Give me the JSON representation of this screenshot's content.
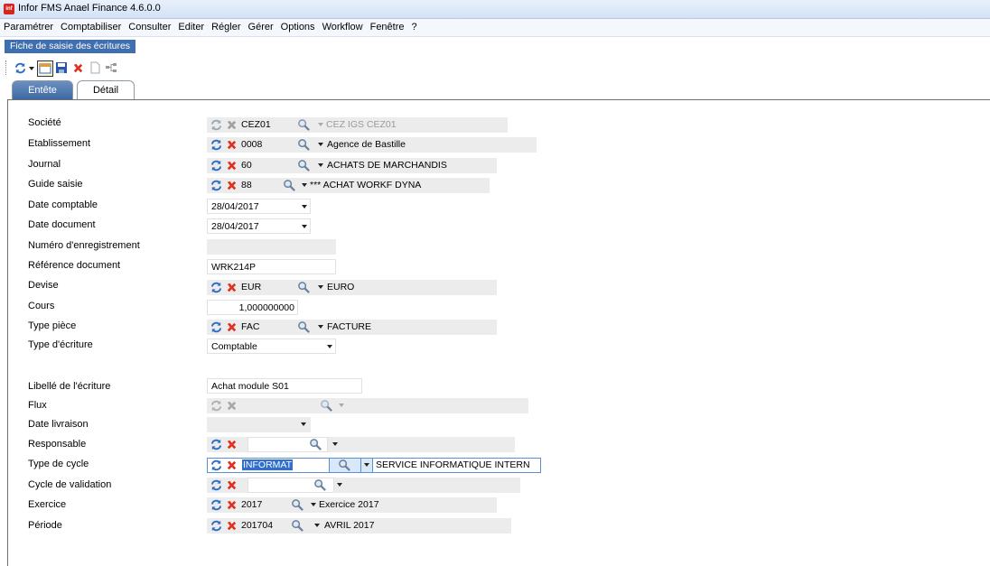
{
  "window": {
    "title": "Infor FMS Anael Finance 4.6.0.0",
    "app_icon": "infor-app-icon"
  },
  "menu": [
    "Paramétrer",
    "Comptabiliser",
    "Consulter",
    "Editer",
    "Régler",
    "Gérer",
    "Options",
    "Workflow",
    "Fenêtre",
    "?"
  ],
  "document_tab": "Fiche de saisie des écritures",
  "tabs": {
    "active": "Entête",
    "inactive": "Détail"
  },
  "form": {
    "societe": {
      "label": "Société",
      "code": "CEZ01",
      "desc": "CEZ IGS CEZ01"
    },
    "etab": {
      "label": "Etablissement",
      "code": "0008",
      "desc": "Agence de Bastille"
    },
    "journal": {
      "label": "Journal",
      "code": "60",
      "desc": "ACHATS DE MARCHANDIS"
    },
    "guide": {
      "label": "Guide saisie",
      "code": "88",
      "desc": "*** ACHAT WORKF DYNA"
    },
    "date_compta": {
      "label": "Date comptable",
      "value": "28/04/2017"
    },
    "date_doc": {
      "label": "Date document",
      "value": "28/04/2017"
    },
    "num_enr": {
      "label": "Numéro d'enregistrement",
      "value": ""
    },
    "ref_doc": {
      "label": "Référence document",
      "value": "WRK214P"
    },
    "devise": {
      "label": "Devise",
      "code": "EUR",
      "desc": "EURO"
    },
    "cours": {
      "label": "Cours",
      "value": "1,000000000"
    },
    "type_piece": {
      "label": "Type pièce",
      "code": "FAC",
      "desc": "FACTURE"
    },
    "type_ecr": {
      "label": "Type d'écriture",
      "value": "Comptable"
    },
    "libelle": {
      "label": "Libellé de l'écriture",
      "value": "Achat module S01"
    },
    "flux": {
      "label": "Flux",
      "code": "",
      "desc": ""
    },
    "date_livr": {
      "label": "Date livraison",
      "value": ""
    },
    "responsable": {
      "label": "Responsable",
      "code": "",
      "desc": ""
    },
    "type_cycle": {
      "label": "Type de cycle",
      "code": "INFORMAT",
      "desc": "SERVICE INFORMATIQUE INTERN"
    },
    "cycle_valid": {
      "label": "Cycle de validation",
      "code": "",
      "desc": ""
    },
    "exercice": {
      "label": "Exercice",
      "code": "2017",
      "desc": "Exercice 2017"
    },
    "periode": {
      "label": "Période",
      "code": "201704",
      "desc": "AVRIL 2017"
    }
  },
  "colors": {
    "accent": "#3f6fae",
    "field_bg": "#ececec",
    "delete_red": "#e0301e",
    "refresh_blue": "#2b6cc4"
  }
}
